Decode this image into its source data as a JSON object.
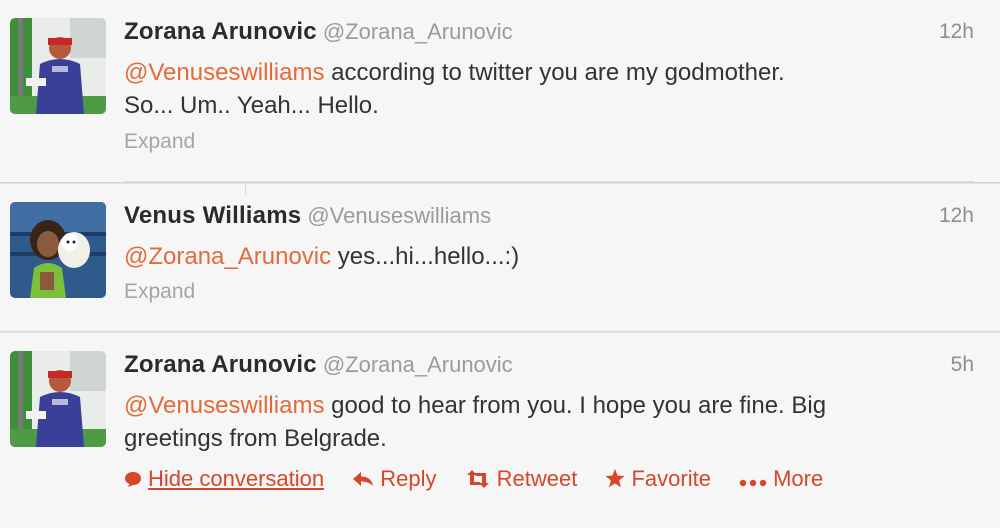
{
  "tweets": [
    {
      "fullname": "Zorana Arunovic",
      "username": "@Zorana_Arunovic",
      "time": "12h",
      "text_mention": "@Venuseswilliams",
      "text_line1_rest": " according to twitter you are my godmother.",
      "text_line2": "So... Um.. Yeah... Hello.",
      "expand": "Expand"
    },
    {
      "fullname": "Venus Williams",
      "username": "@Venuseswilliams",
      "time": "12h",
      "text_mention": "@Zorana_Arunovic",
      "text_line1_rest": " yes...hi...hello...:)",
      "expand": "Expand"
    },
    {
      "fullname": "Zorana Arunovic",
      "username": "@Zorana_Arunovic",
      "time": "5h",
      "text_mention": "@Venuseswilliams",
      "text_line1_rest": " good to hear from you. I hope you are fine. Big",
      "text_line2": "greetings from Belgrade.",
      "actions": {
        "hide_conversation": "Hide conversation",
        "reply": "Reply",
        "retweet": "Retweet",
        "favorite": "Favorite",
        "more": "More"
      }
    }
  ],
  "colors": {
    "mention": "#e46a3a",
    "action": "#d6472a",
    "meta": "#9b9b9b"
  },
  "icons": {
    "hide_conversation": "speech-bubble-icon",
    "reply": "reply-arrow-icon",
    "retweet": "retweet-icon",
    "favorite": "star-icon",
    "more": "dots-icon"
  }
}
